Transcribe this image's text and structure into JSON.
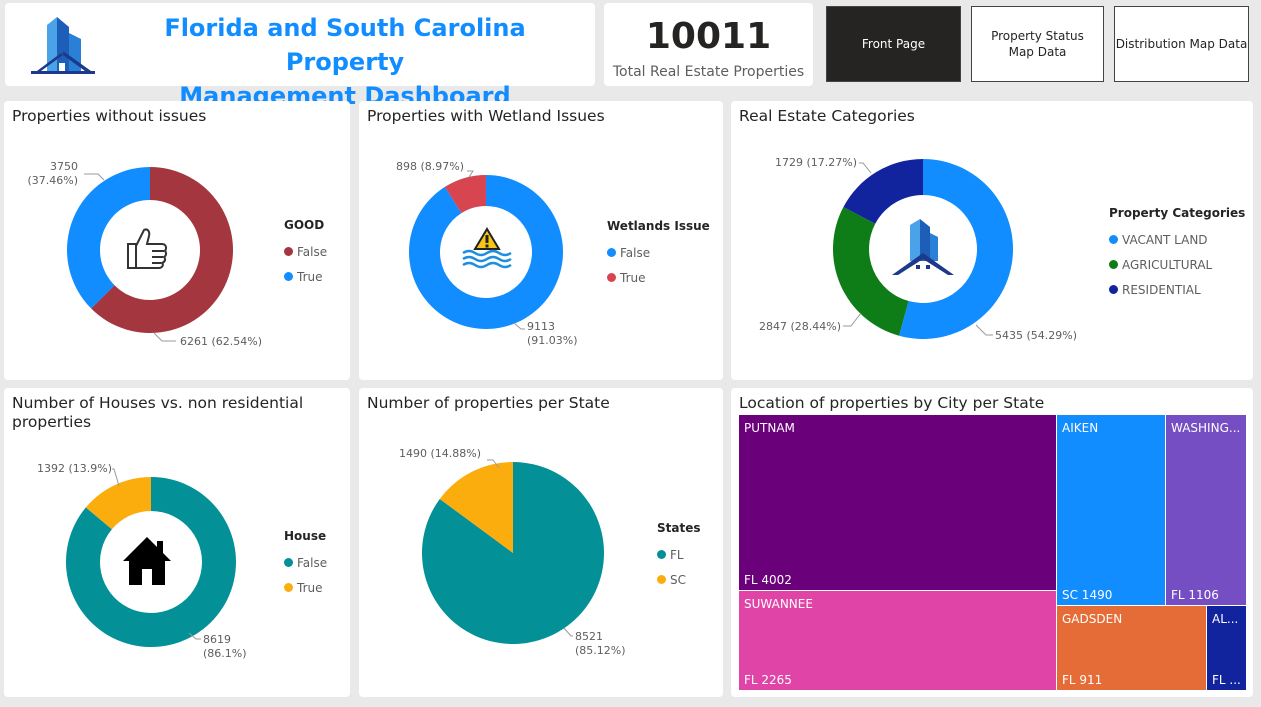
{
  "header": {
    "title_line1": "Florida and South Carolina Property",
    "title_line2": "Management Dashboard",
    "kpi_value": "10011",
    "kpi_label": "Total Real Estate Properties",
    "title_color": "#118dff"
  },
  "nav": {
    "front_page": "Front Page",
    "property_status": "Property Status Map Data",
    "distribution": "Distribution Map Data"
  },
  "chart_data": [
    {
      "id": "good",
      "type": "donut",
      "title": "Properties without issues",
      "legend_title": "GOOD",
      "slices": [
        {
          "name": "False",
          "value": 6261,
          "label": "6261 (62.54%)",
          "color": "#a4363f"
        },
        {
          "name": "True",
          "value": 3750,
          "label": "3750 (37.46%)",
          "color": "#118dff"
        }
      ],
      "icon": "thumbs-up-icon"
    },
    {
      "id": "wetland",
      "type": "donut",
      "title": "Properties with Wetland Issues",
      "legend_title": "Wetlands Issue",
      "slices": [
        {
          "name": "False",
          "value": 9113,
          "label": "9113 (91.03%)",
          "color": "#118dff"
        },
        {
          "name": "True",
          "value": 898,
          "label": "898 (8.97%)",
          "color": "#d64550"
        }
      ],
      "icon": "flood-warning-icon"
    },
    {
      "id": "categories",
      "type": "donut",
      "title": "Real Estate Categories",
      "legend_title": "Property Categories",
      "slices": [
        {
          "name": "VACANT LAND",
          "value": 5435,
          "label": "5435 (54.29%)",
          "color": "#118dff"
        },
        {
          "name": "AGRICULTURAL",
          "value": 2847,
          "label": "2847 (28.44%)",
          "color": "#0e7c17"
        },
        {
          "name": "RESIDENTIAL",
          "value": 1729,
          "label": "1729 (17.27%)",
          "color": "#12239e"
        }
      ],
      "icon": "building-icon"
    },
    {
      "id": "house",
      "type": "donut",
      "title": "Number of Houses vs. non residential properties",
      "title_line1": "Number of Houses vs. non residential",
      "title_line2": "properties",
      "legend_title": "House",
      "slices": [
        {
          "name": "False",
          "value": 8619,
          "label": "8619 (86.1%)",
          "color": "#039096"
        },
        {
          "name": "True",
          "value": 1392,
          "label": "1392 (13.9%)",
          "color": "#fbad0e"
        }
      ],
      "icon": "house-icon"
    },
    {
      "id": "states",
      "type": "pie",
      "title": "Number of properties per State",
      "legend_title": "States",
      "slices": [
        {
          "name": "FL",
          "value": 8521,
          "label": "8521 (85.12%)",
          "color": "#039096"
        },
        {
          "name": "SC",
          "value": 1490,
          "label": "1490 (14.88%)",
          "color": "#fbad0e"
        }
      ]
    },
    {
      "id": "treemap",
      "type": "treemap",
      "title": "Location of properties by City per State",
      "cells": [
        {
          "city": "PUTNAM",
          "state_value": "FL 4002",
          "value": 4002,
          "color": "#6b007b"
        },
        {
          "city": "SUWANNEE",
          "state_value": "FL 2265",
          "value": 2265,
          "color": "#e044a7"
        },
        {
          "city": "AIKEN",
          "state_value": "SC 1490",
          "value": 1490,
          "color": "#118dff"
        },
        {
          "city": "WASHING...",
          "state_value": "FL 1106",
          "value": 1106,
          "color": "#744ec2"
        },
        {
          "city": "GADSDEN",
          "state_value": "FL 911",
          "value": 911,
          "color": "#e66c37"
        },
        {
          "city": "AL...",
          "state_value": "FL ...",
          "value": 237,
          "color": "#12239e"
        }
      ]
    }
  ]
}
